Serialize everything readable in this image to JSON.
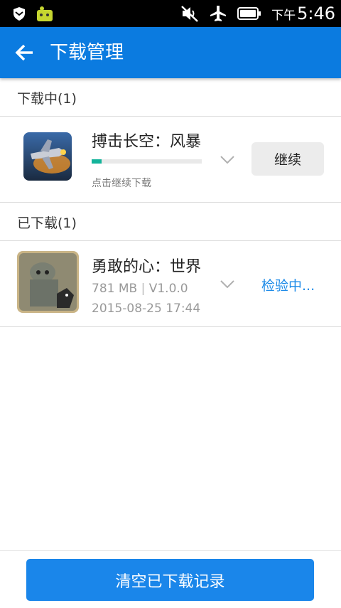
{
  "status_bar": {
    "ampm": "下午",
    "time": "5:46",
    "icons": [
      "shield-icon",
      "android-app-icon",
      "mute-icon",
      "airplane-icon",
      "battery-icon"
    ]
  },
  "app_bar": {
    "title": "下载管理",
    "back_icon": "back-arrow-icon"
  },
  "downloading": {
    "header": "下载中(1)",
    "items": [
      {
        "name": "搏击长空：风暴",
        "progress": 0.09,
        "hint": "点击继续下载",
        "action": "继续"
      }
    ]
  },
  "downloaded": {
    "header": "已下载(1)",
    "items": [
      {
        "name": "勇敢的心：世界",
        "size": "781 MB",
        "version": "V1.0.0",
        "date": "2015-08-25 17:44",
        "status": "检验中..."
      }
    ]
  },
  "footer": {
    "clear_label": "清空已下载记录"
  },
  "colors": {
    "app_bar": "#0b7be0",
    "progress": "#13b39a",
    "status_link": "#1d8be8",
    "primary_button": "#1a86ea"
  }
}
